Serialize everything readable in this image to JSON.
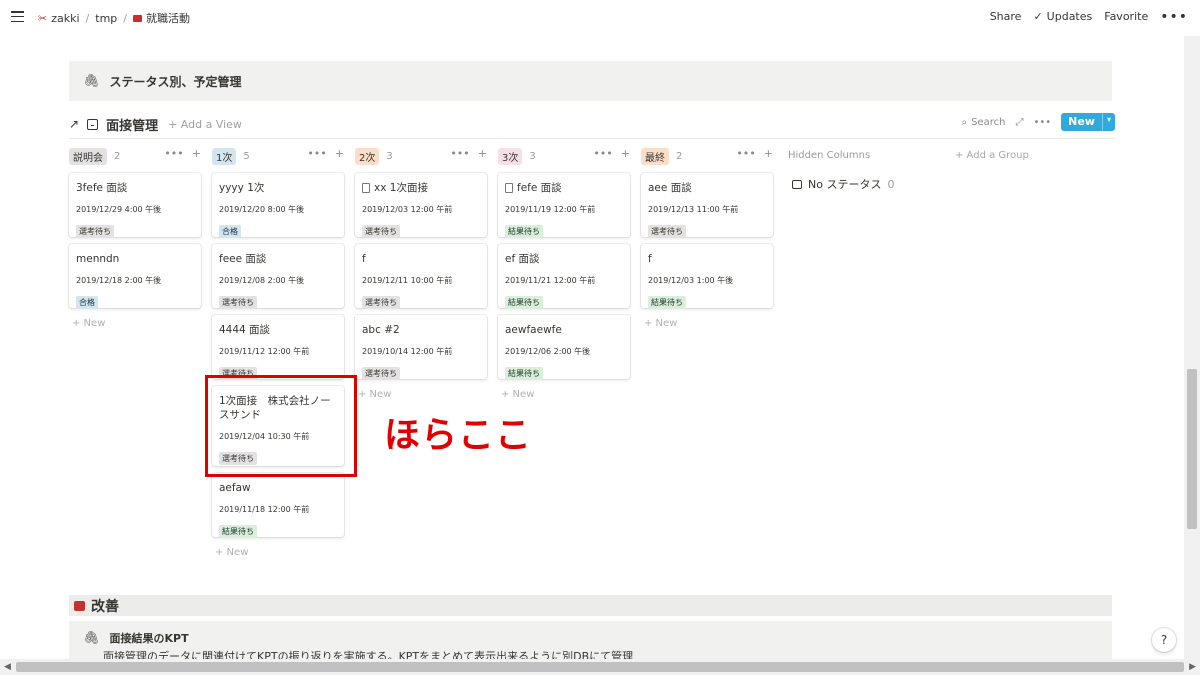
{
  "breadcrumb": {
    "workspace": "zakki",
    "folder": "tmp",
    "page": "就職活動"
  },
  "topbar": {
    "share": "Share",
    "updates": "Updates",
    "favorite": "Favorite",
    "more": "•••"
  },
  "callout": {
    "text": "ステータス別、予定管理"
  },
  "board": {
    "title": "面接管理",
    "add_view": "+ Add a View",
    "search": "Search",
    "new_label": "New",
    "new_caret": "▾",
    "expand": "⤢",
    "more": "•••"
  },
  "columns": [
    {
      "name": "説明会",
      "count": "2",
      "color": "#e3e2e0",
      "new_label": "+ New",
      "cards": [
        {
          "title": "3fefe 面談",
          "date": "2019/12/29 4:00 午後",
          "status": "選考待ち",
          "status_color": "gray"
        },
        {
          "title": "menndn",
          "date": "2019/12/18 2:00 午後",
          "status": "合格",
          "status_color": "blue"
        }
      ]
    },
    {
      "name": "1次",
      "count": "5",
      "color": "#d3e5ef",
      "new_label": "+ New",
      "cards": [
        {
          "title": "yyyy 1次",
          "date": "2019/12/20 8:00 午後",
          "status": "合格",
          "status_color": "blue"
        },
        {
          "title": "feee 面談",
          "date": "2019/12/08 2:00 午後",
          "status": "選考待ち",
          "status_color": "gray"
        },
        {
          "title": "4444 面談",
          "date": "2019/11/12 12:00 午前",
          "status": "選考待ち",
          "status_color": "gray"
        },
        {
          "title": "1次面接　株式会社ノースサンド",
          "date": "2019/12/04 10:30 午前",
          "status": "選考待ち",
          "status_color": "gray"
        },
        {
          "title": "aefaw",
          "date": "2019/11/18 12:00 午前",
          "status": "結果待ち",
          "status_color": "green"
        }
      ]
    },
    {
      "name": "2次",
      "count": "3",
      "color": "#fadec9",
      "new_label": "+ New",
      "cards": [
        {
          "title": "xx 1次面接",
          "date": "2019/12/03 12:00 午前",
          "status": "選考待ち",
          "status_color": "gray",
          "doc": true
        },
        {
          "title": "f",
          "date": "2019/12/11 10:00 午前",
          "status": "選考待ち",
          "status_color": "gray"
        },
        {
          "title": "abc #2",
          "date": "2019/10/14 12:00 午前",
          "status": "選考待ち",
          "status_color": "gray"
        }
      ]
    },
    {
      "name": "3次",
      "count": "3",
      "color": "#f5e0e9",
      "new_label": "+ New",
      "cards": [
        {
          "title": "fefe 面談",
          "date": "2019/11/19 12:00 午前",
          "status": "結果待ち",
          "status_color": "green",
          "doc": true
        },
        {
          "title": "ef 面談",
          "date": "2019/11/21 12:00 午前",
          "status": "結果待ち",
          "status_color": "green"
        },
        {
          "title": "aewfaewfe",
          "date": "2019/12/06 2:00 午後",
          "status": "結果待ち",
          "status_color": "green"
        }
      ]
    },
    {
      "name": "最終",
      "count": "2",
      "color": "#fadec9",
      "new_label": "+ New",
      "cards": [
        {
          "title": "aee 面談",
          "date": "2019/12/13 11:00 午前",
          "status": "選考待ち",
          "status_color": "gray"
        },
        {
          "title": "f",
          "date": "2019/12/03 1:00 午後",
          "status": "結果待ち",
          "status_color": "green"
        }
      ]
    }
  ],
  "hidden_columns": {
    "label": "Hidden Columns",
    "add_group": "+ Add a Group",
    "no_status": "No ステータス",
    "no_status_count": "0"
  },
  "annotation": {
    "text": "ほらここ",
    "color": "#e00000"
  },
  "section": {
    "title": "改善"
  },
  "kpt": {
    "title": "面接結果のKPT",
    "body": "面接管理のデータに関連付けてKPTの振り返りを実施する。KPTをまとめて表示出来るように別DBにて管理"
  },
  "help": "?"
}
